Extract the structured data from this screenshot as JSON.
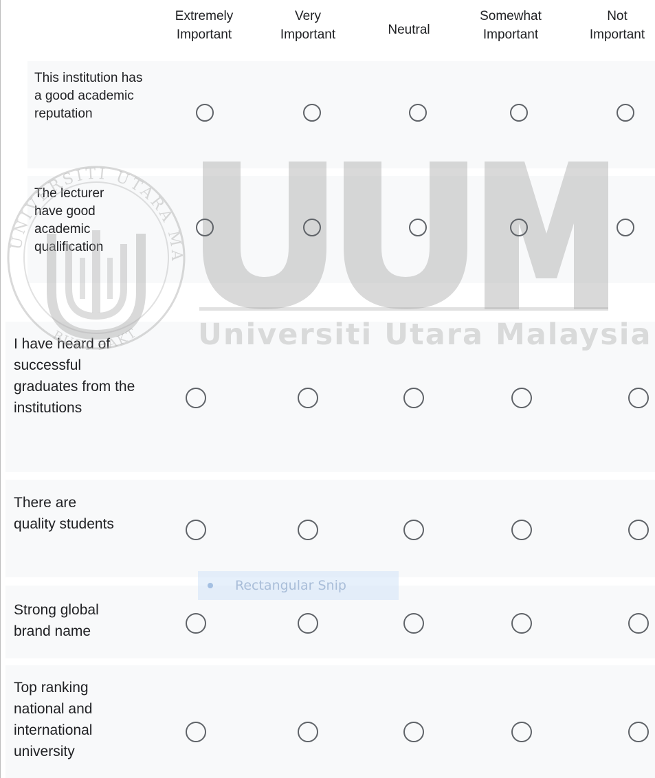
{
  "columns": [
    {
      "label": "Extremely\nImportant"
    },
    {
      "label": "Very\nImportant"
    },
    {
      "label": "Neutral"
    },
    {
      "label": "Somewhat\nImportant"
    },
    {
      "label": "Not\nImportant"
    }
  ],
  "rows": [
    {
      "label": "This institution has a good academic reputation"
    },
    {
      "label": "The lecturer have good academic qualification"
    },
    {
      "label": "I have heard of successful graduates from the institutions"
    },
    {
      "label": "There are quality students"
    },
    {
      "label": "Strong global brand name"
    },
    {
      "label": "Top ranking national and international university"
    }
  ],
  "watermark": {
    "logo_text": "UUM",
    "name": "Universiti Utara Malaysia",
    "seal_text": "UNIVERSITI UTARA MALAYSIA BUDI BAKTI"
  },
  "snip_overlay": {
    "label": "Rectangular Snip"
  },
  "colors": {
    "row_background": "#f8f9fa",
    "radio_border": "#5f6368",
    "text": "#202124"
  }
}
